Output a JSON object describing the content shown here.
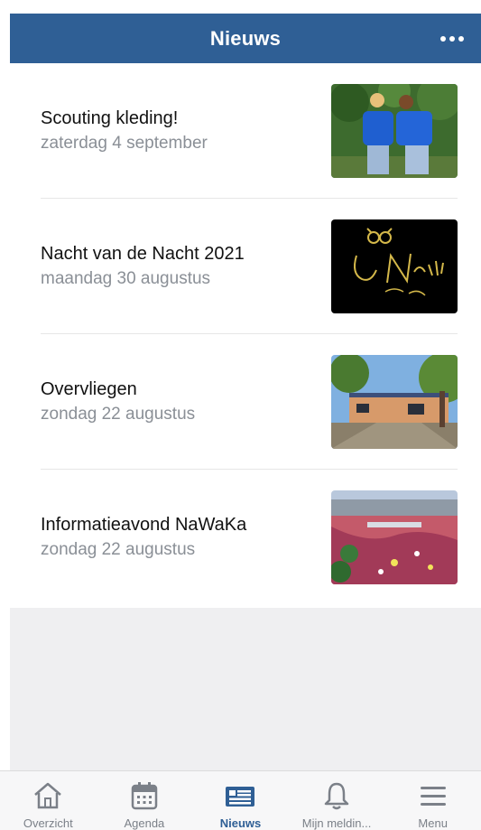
{
  "header": {
    "title": "Nieuws",
    "more_icon": "more-dots-icon"
  },
  "news": [
    {
      "title": "Scouting kleding!",
      "date": "zaterdag 4 september"
    },
    {
      "title": "Nacht van de Nacht 2021",
      "date": "maandag 30 augustus"
    },
    {
      "title": "Overvliegen",
      "date": "zondag 22 augustus"
    },
    {
      "title": "Informatieavond NaWaKa",
      "date": "zondag 22 augustus"
    }
  ],
  "tabs": [
    {
      "label": "Overzicht",
      "icon": "home-icon"
    },
    {
      "label": "Agenda",
      "icon": "calendar-icon"
    },
    {
      "label": "Nieuws",
      "icon": "news-icon",
      "active": true
    },
    {
      "label": "Mijn meldin...",
      "icon": "bell-icon"
    },
    {
      "label": "Menu",
      "icon": "menu-icon"
    }
  ],
  "colors": {
    "header": "#2f5f95",
    "active_tab": "#2f5f95",
    "inactive_tab": "#7b8088"
  }
}
